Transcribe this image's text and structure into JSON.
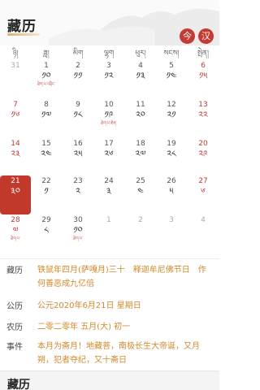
{
  "header": {
    "title": "藏历",
    "today_button": "今",
    "han_button": "汉"
  },
  "weekdays": [
    "ཉི།",
    "ཟླ།",
    "མིག",
    "ལྷག",
    "ཕུར།",
    "སངས།",
    "སྤེན།"
  ],
  "calendar": {
    "rows": [
      [
        {
          "num": "31",
          "tib": "",
          "fest": "",
          "type": "faded"
        },
        {
          "num": "1",
          "tib": "༡༠",
          "fest": "ཐེག་པ་འབྲིང་",
          "type": "normal"
        },
        {
          "num": "2",
          "tib": "༡༡",
          "fest": "",
          "type": "normal"
        },
        {
          "num": "3",
          "tib": "༡༢",
          "fest": "",
          "type": "normal"
        },
        {
          "num": "4",
          "tib": "༡༣",
          "fest": "",
          "type": "normal"
        },
        {
          "num": "5",
          "tib": "༡༤",
          "fest": "",
          "type": "normal"
        },
        {
          "num": "6",
          "tib": "༡༥",
          "fest": "",
          "type": "weekend"
        }
      ],
      [
        {
          "num": "7",
          "tib": "༡༦",
          "fest": "",
          "type": "weekend"
        },
        {
          "num": "8",
          "tib": "༡༧",
          "fest": "",
          "type": "normal"
        },
        {
          "num": "9",
          "tib": "༡༨",
          "fest": "",
          "type": "normal"
        },
        {
          "num": "10",
          "tib": "༡༩",
          "fest": "ཐེག་པ་ཆེན་",
          "type": "normal"
        },
        {
          "num": "11",
          "tib": "༢༠",
          "fest": "",
          "type": "normal"
        },
        {
          "num": "12",
          "tib": "༢༡",
          "fest": "",
          "type": "normal"
        },
        {
          "num": "13",
          "tib": "༢༢",
          "fest": "",
          "type": "weekend"
        }
      ],
      [
        {
          "num": "14",
          "tib": "༢༣",
          "fest": "",
          "type": "weekend"
        },
        {
          "num": "15",
          "tib": "༢༤",
          "fest": "",
          "type": "normal"
        },
        {
          "num": "16",
          "tib": "༢༥",
          "fest": "",
          "type": "normal"
        },
        {
          "num": "17",
          "tib": "༢༦",
          "fest": "",
          "type": "normal"
        },
        {
          "num": "18",
          "tib": "༢༧",
          "fest": "",
          "type": "normal"
        },
        {
          "num": "19",
          "tib": "༢༨",
          "fest": "",
          "type": "normal"
        },
        {
          "num": "20",
          "tib": "༢༩",
          "fest": "",
          "type": "weekend"
        }
      ],
      [
        {
          "num": "21",
          "tib": "༣༠",
          "fest": "ཐེག་པ་ཆེན་",
          "type": "selected"
        },
        {
          "num": "22",
          "tib": "༡",
          "fest": "",
          "type": "normal"
        },
        {
          "num": "23",
          "tib": "༢",
          "fest": "",
          "type": "normal"
        },
        {
          "num": "24",
          "tib": "༣",
          "fest": "",
          "type": "normal"
        },
        {
          "num": "25",
          "tib": "༤",
          "fest": "",
          "type": "normal"
        },
        {
          "num": "26",
          "tib": "༥",
          "fest": "",
          "type": "normal"
        },
        {
          "num": "27",
          "tib": "༦",
          "fest": "",
          "type": "weekend"
        }
      ],
      [
        {
          "num": "28",
          "tib": "༧",
          "fest": "ཐེག་པ་",
          "type": "weekend"
        },
        {
          "num": "29",
          "tib": "༨",
          "fest": "",
          "type": "normal"
        },
        {
          "num": "30",
          "tib": "༡༠",
          "fest": "ཐེག་པ་",
          "type": "normal"
        },
        {
          "num": "1",
          "tib": "",
          "fest": "",
          "type": "faded"
        },
        {
          "num": "2",
          "tib": "",
          "fest": "",
          "type": "faded"
        },
        {
          "num": "3",
          "tib": "",
          "fest": "",
          "type": "faded"
        },
        {
          "num": "4",
          "tib": "",
          "fest": "",
          "type": "faded"
        }
      ]
    ]
  },
  "info": {
    "zangli_label": "藏历",
    "zangli_value": "铁鼠年四月(萨嘎月)三十　释迦牟尼佛节日　作何善恶成九亿倍",
    "gongli_label": "公历",
    "gongli_value": "公元2020年6月21日 星期日",
    "nongli_label": "农历",
    "nongli_value": "二零二零年 五月(大) 初一",
    "event_label": "事件",
    "event_value": "本月为斋月！地藏菩，南极长生大帝诞，又月朔，犯者夺纪，又十斋日"
  },
  "bottom": {
    "title": "藏历"
  },
  "colors": {
    "accent": "#c33b34",
    "gold": "#d08a2c"
  }
}
